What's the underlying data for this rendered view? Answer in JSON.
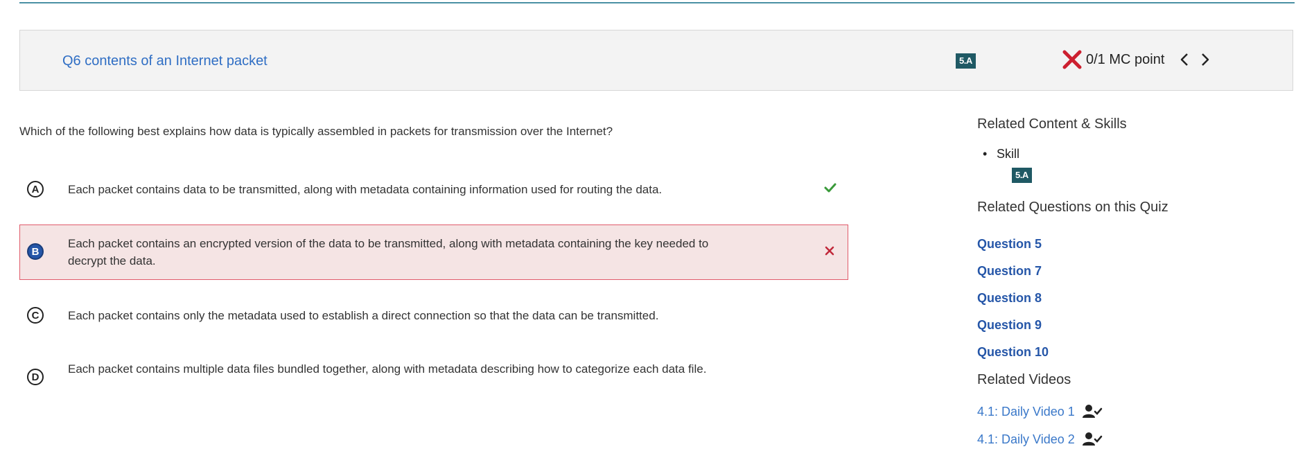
{
  "question": {
    "title": "Q6 contents of an Internet packet",
    "skill_tag": "5.A",
    "score": "0/1 MC point",
    "prompt": "Which of the following best explains how data is typically assembled in packets for transmission over the Internet?"
  },
  "choices": [
    {
      "letter": "A",
      "text": "Each packet contains data to be transmitted, along with metadata containing information used for routing the data.",
      "status": "correct"
    },
    {
      "letter": "B",
      "text": "Each packet contains an encrypted version of the data to be transmitted, along with metadata containing the key needed to decrypt the data.",
      "status": "selected-incorrect"
    },
    {
      "letter": "C",
      "text": "Each packet contains only the metadata used to establish a direct connection so that the data can be transmitted.",
      "status": "none"
    },
    {
      "letter": "D",
      "text": "Each packet contains multiple data files bundled together, along with metadata describing how to categorize each data file.",
      "status": "none"
    }
  ],
  "sidebar": {
    "related_content_heading": "Related Content & Skills",
    "skill_label": "Skill",
    "skill_tag": "5.A",
    "related_questions_heading": "Related Questions on this Quiz",
    "questions": [
      "Question 5",
      "Question 7",
      "Question 8",
      "Question 9",
      "Question 10"
    ],
    "related_videos_heading": "Related Videos",
    "videos": [
      {
        "label": "4.1: Daily Video 1",
        "icon": "person-check-icon"
      },
      {
        "label": "4.1: Daily Video 2",
        "icon": "person-check-icon"
      }
    ]
  },
  "colors": {
    "link": "#2f6ec4",
    "skill_tag_bg": "#1f5964",
    "incorrect_red": "#cc1f2f",
    "correct_green": "#3a9a3a",
    "selected_bg": "#f5e4e4"
  }
}
